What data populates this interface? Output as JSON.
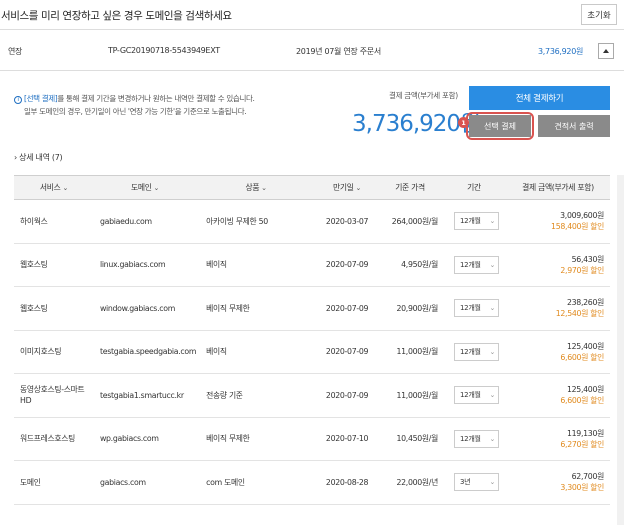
{
  "header": {
    "title": "서비스를 미리 연장하고 싶은 경우 도메인을 검색하세요",
    "reset_label": "초기화"
  },
  "order": {
    "type": "연장",
    "code": "TP-GC20190718-5543949EXT",
    "description": "2019년 07월 연장 주문서",
    "amount": "3,736,920원"
  },
  "notice": {
    "highlight": "[선택 결제]",
    "line1_rest": "를 통해 결제 기간을 변경하거나 원하는 내역만 결제할 수 있습니다.",
    "line2": "일부 도메인의 경우, 만기일이 아닌 '연장 가능 기한'을 기준으로 노출됩니다."
  },
  "payment": {
    "label": "결제 금액(부가세 포함)",
    "total": "3,736,920원",
    "pay_all_label": "전체 결제하기",
    "pay_select_label": "선택 결제",
    "quote_label": "견적서 출력",
    "step_badge": "1"
  },
  "details": {
    "toggle_label": "› 상세 내역  (7)"
  },
  "table": {
    "headers": {
      "service": "서비스",
      "domain": "도메인",
      "product": "상품",
      "expiry": "만기일",
      "base_price": "기준 가격",
      "period": "기간",
      "payment": "결제 금액(부가세 포함)"
    },
    "rows": [
      {
        "service": "하이웍스",
        "domain": "gabiaedu.com",
        "product": "아카이빙 무제한 50",
        "expiry": "2020-03-07",
        "base_price": "264,000원/월",
        "period": "12개월",
        "amount": "3,009,600원",
        "discount": "158,400원 할인"
      },
      {
        "service": "웹호스팅",
        "domain": "linux.gabiacs.com",
        "product": "베이직",
        "expiry": "2020-07-09",
        "base_price": "4,950원/월",
        "period": "12개월",
        "amount": "56,430원",
        "discount": "2,970원 할인"
      },
      {
        "service": "웹호스팅",
        "domain": "window.gabiacs.com",
        "product": "베이직 무제한",
        "expiry": "2020-07-09",
        "base_price": "20,900원/월",
        "period": "12개월",
        "amount": "238,260원",
        "discount": "12,540원 할인"
      },
      {
        "service": "이미지호스팅",
        "domain": "testgabia.speedgabia.com",
        "product": "베이직",
        "expiry": "2020-07-09",
        "base_price": "11,000원/월",
        "period": "12개월",
        "amount": "125,400원",
        "discount": "6,600원 할인"
      },
      {
        "service": "동영상호스팅-스마트HD",
        "domain": "testgabia1.smartucc.kr",
        "product": "전송량 기준",
        "expiry": "2020-07-09",
        "base_price": "11,000원/월",
        "period": "12개월",
        "amount": "125,400원",
        "discount": "6,600원 할인"
      },
      {
        "service": "워드프레스호스팅",
        "domain": "wp.gabiacs.com",
        "product": "베이직 무제한",
        "expiry": "2020-07-10",
        "base_price": "10,450원/월",
        "period": "12개월",
        "amount": "119,130원",
        "discount": "6,270원 할인"
      },
      {
        "service": "도메인",
        "domain": "gabiacs.com",
        "product": "com 도메인",
        "expiry": "2020-08-28",
        "base_price": "22,000원/년",
        "period": "3년",
        "amount": "62,700원",
        "discount": "3,300원 할인"
      }
    ]
  },
  "colors": {
    "accent": "#2a8de3",
    "amount_blue": "#2a7fcf",
    "discount_orange": "#e08a1e",
    "highlight_red": "#d9534f",
    "button_gray": "#8a8a8a"
  }
}
